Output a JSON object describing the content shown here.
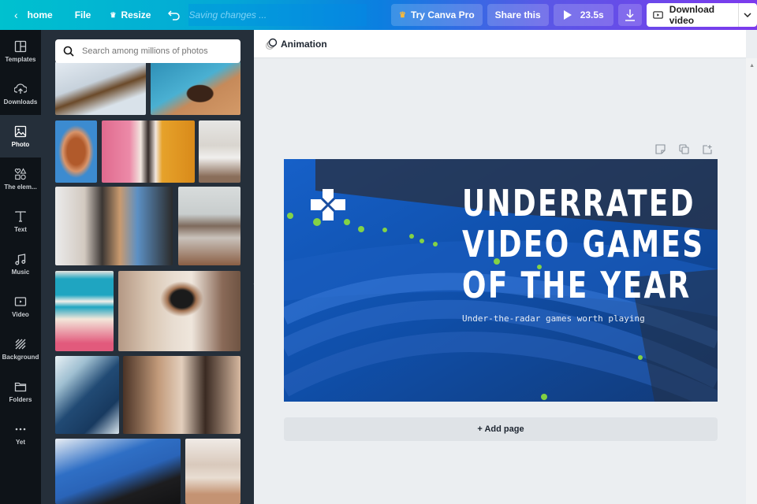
{
  "topbar": {
    "home_label": "home",
    "file_label": "File",
    "resize_label": "Resize",
    "saving_text": "Saving changes ...",
    "try_pro_label": "Try Canva Pro",
    "share_label": "Share this",
    "duration": "23.5s",
    "download_label": "Download video"
  },
  "sidebar": {
    "items": [
      {
        "label": "Templates",
        "icon": "templates-icon"
      },
      {
        "label": "Downloads",
        "icon": "upload-cloud-icon"
      },
      {
        "label": "Photo",
        "icon": "photo-icon",
        "active": true
      },
      {
        "label": "The elem...",
        "icon": "elements-icon"
      },
      {
        "label": "Text",
        "icon": "text-icon"
      },
      {
        "label": "Music",
        "icon": "music-icon"
      },
      {
        "label": "Video",
        "icon": "video-icon"
      },
      {
        "label": "Background",
        "icon": "background-icon"
      },
      {
        "label": "Folders",
        "icon": "folder-icon"
      },
      {
        "label": "Yet",
        "icon": "more-icon"
      }
    ]
  },
  "photo_panel": {
    "search_placeholder": "Search among millions of photos",
    "photos": [
      {
        "subject": "tree branches against sky"
      },
      {
        "subject": "dog by pool"
      },
      {
        "subject": "woman with hair over face"
      },
      {
        "subject": "woman hanging colorful laundry"
      },
      {
        "subject": "woman with headphones"
      },
      {
        "subject": "woman with laptop in kitchen"
      },
      {
        "subject": "rocky seashore"
      },
      {
        "subject": "child holding paper"
      },
      {
        "subject": "person in cat face mask"
      },
      {
        "subject": "ocean waves from above"
      },
      {
        "subject": "couple with ukulele"
      },
      {
        "subject": "video call on laptop"
      },
      {
        "subject": "room with wall photos"
      }
    ]
  },
  "editor": {
    "animation_label": "Animation",
    "add_page_label": "+ Add page",
    "design": {
      "headline_lines": [
        "UNDERRATED",
        "VIDEO GAMES",
        "OF THE YEAR"
      ],
      "subtitle": "Under-the-radar games worth playing"
    }
  }
}
